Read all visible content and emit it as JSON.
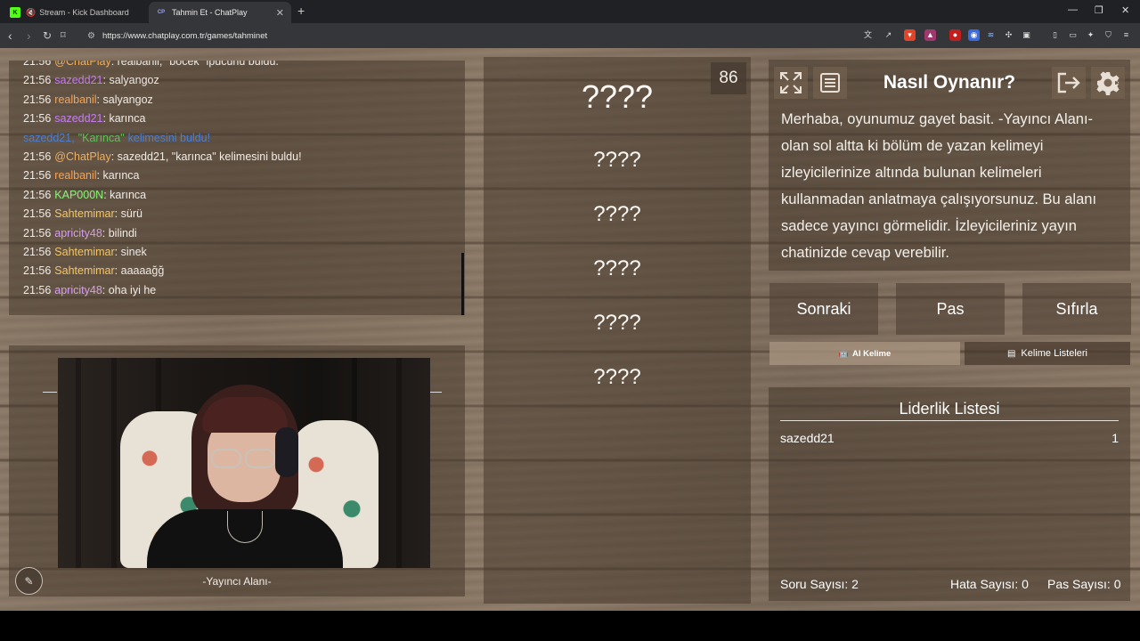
{
  "browser": {
    "tabs": [
      {
        "title": "Stream - Kick Dashboard",
        "favicon": "kick-icon",
        "active": false
      },
      {
        "title": "Tahmin Et - ChatPlay",
        "favicon": "chatplay-icon",
        "active": true
      }
    ],
    "url": "https://www.chatplay.com.tr/games/tahminet"
  },
  "chat": {
    "messages": [
      {
        "time": "21:56",
        "user": "@ChatPlay",
        "user_color": "#f0b060",
        "text": ": realbanil, \"böcek\" ipucunu buldu."
      },
      {
        "time": "21:56",
        "user": "sazedd21",
        "user_color": "#c67cf2",
        "text": ": salyangoz"
      },
      {
        "time": "21:56",
        "user": "realbanil",
        "user_color": "#f2a35a",
        "text": ": salyangoz"
      },
      {
        "time": "21:56",
        "user": "sazedd21",
        "user_color": "#c67cf2",
        "text": ": karınca"
      },
      {
        "system": true,
        "user": "sazedd21,",
        "word": "\"Karınca\"",
        "text": "kelimesini buldu!"
      },
      {
        "time": "21:56",
        "user": "@ChatPlay",
        "user_color": "#f0b060",
        "text": ": sazedd21, \"karınca\" kelimesini buldu!"
      },
      {
        "time": "21:56",
        "user": "realbanil",
        "user_color": "#f2a35a",
        "text": ": karınca"
      },
      {
        "time": "21:56",
        "user": "KAP000N",
        "user_color": "#8cf27a",
        "text": ": karınca"
      },
      {
        "time": "21:56",
        "user": "Sahtemimar",
        "user_color": "#f2c66a",
        "text": ": sürü"
      },
      {
        "time": "21:56",
        "user": "apricity48",
        "user_color": "#d79cf2",
        "text": ": bilindi"
      },
      {
        "time": "21:56",
        "user": "Sahtemimar",
        "user_color": "#f2c66a",
        "text": ": sinek"
      },
      {
        "time": "21:56",
        "user": "Sahtemimar",
        "user_color": "#f2c66a",
        "text": ": aaaaağğ"
      },
      {
        "time": "21:56",
        "user": "apricity48",
        "user_color": "#d79cf2",
        "text": ": oha iyi he"
      }
    ]
  },
  "streamer": {
    "label": "-Yayıncı Alanı-"
  },
  "words": {
    "timer": "86",
    "main": "????",
    "hidden": [
      "????",
      "????",
      "????",
      "????",
      "????"
    ]
  },
  "howto": {
    "title": "Nasıl Oynanır?",
    "text": "Merhaba, oyunumuz gayet basit. -Yayıncı Alanı- olan sol altta ki bölüm de yazan kelimeyi izleyicilerinize altında bulunan kelimeleri kullanmadan anlatmaya çalışıyorsunuz. Bu alanı sadece yayıncı görmelidir. İzleyicileriniz yayın chatinizde cevap verebilir."
  },
  "actions": {
    "next": "Sonraki",
    "pass": "Pas",
    "reset": "Sıfırla"
  },
  "tabs": {
    "ai": "AI Kelime",
    "lists": "Kelime Listeleri"
  },
  "leaderboard": {
    "title": "Liderlik Listesi",
    "rows": [
      {
        "name": "sazedd21",
        "score": "1"
      }
    ],
    "question_count": "Soru Sayısı: 2",
    "error_count": "Hata Sayısı: 0",
    "pass_count": "Pas Sayısı: 0"
  }
}
